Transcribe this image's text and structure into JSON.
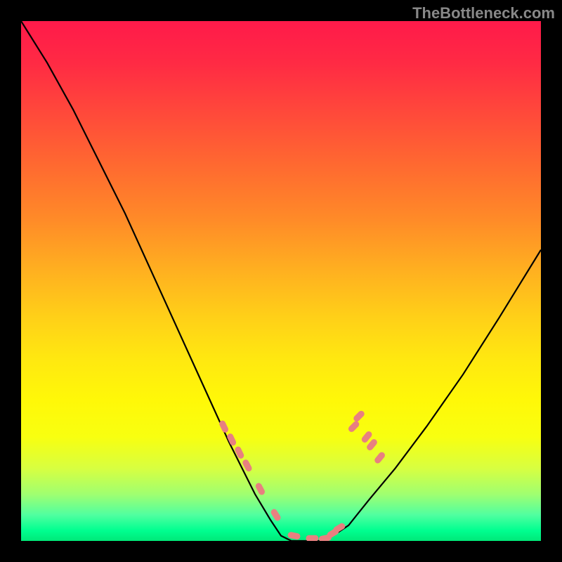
{
  "watermark": "TheBottleneck.com",
  "chart_data": {
    "type": "line",
    "title": "",
    "xlabel": "",
    "ylabel": "",
    "xlim": [
      0,
      100
    ],
    "ylim": [
      0,
      100
    ],
    "grid": false,
    "background_gradient": {
      "top": "#ff1a4a",
      "middle": "#ffe810",
      "bottom": "#00e878"
    },
    "series": [
      {
        "name": "bottleneck-curve",
        "color": "#000000",
        "x": [
          0,
          5,
          10,
          15,
          20,
          25,
          30,
          35,
          40,
          45,
          48,
          50,
          52,
          55,
          58,
          60,
          63,
          67,
          72,
          78,
          85,
          92,
          100
        ],
        "y": [
          100,
          92,
          83,
          73,
          63,
          52,
          41,
          30,
          19,
          9,
          4,
          1,
          0,
          0,
          0,
          1,
          3,
          8,
          14,
          22,
          32,
          43,
          56
        ]
      }
    ],
    "markers": {
      "name": "highlighted-points",
      "color": "#e88080",
      "shape": "rounded-dash",
      "x": [
        39,
        40.5,
        42,
        43.5,
        46,
        49,
        52.5,
        56,
        58.5,
        60,
        61.2,
        64,
        65,
        66.5,
        67.5,
        69
      ],
      "y": [
        22,
        19.5,
        17,
        14.5,
        10,
        5,
        1,
        0.5,
        0.5,
        1.5,
        2.5,
        22,
        24,
        20,
        18.5,
        16
      ]
    }
  }
}
